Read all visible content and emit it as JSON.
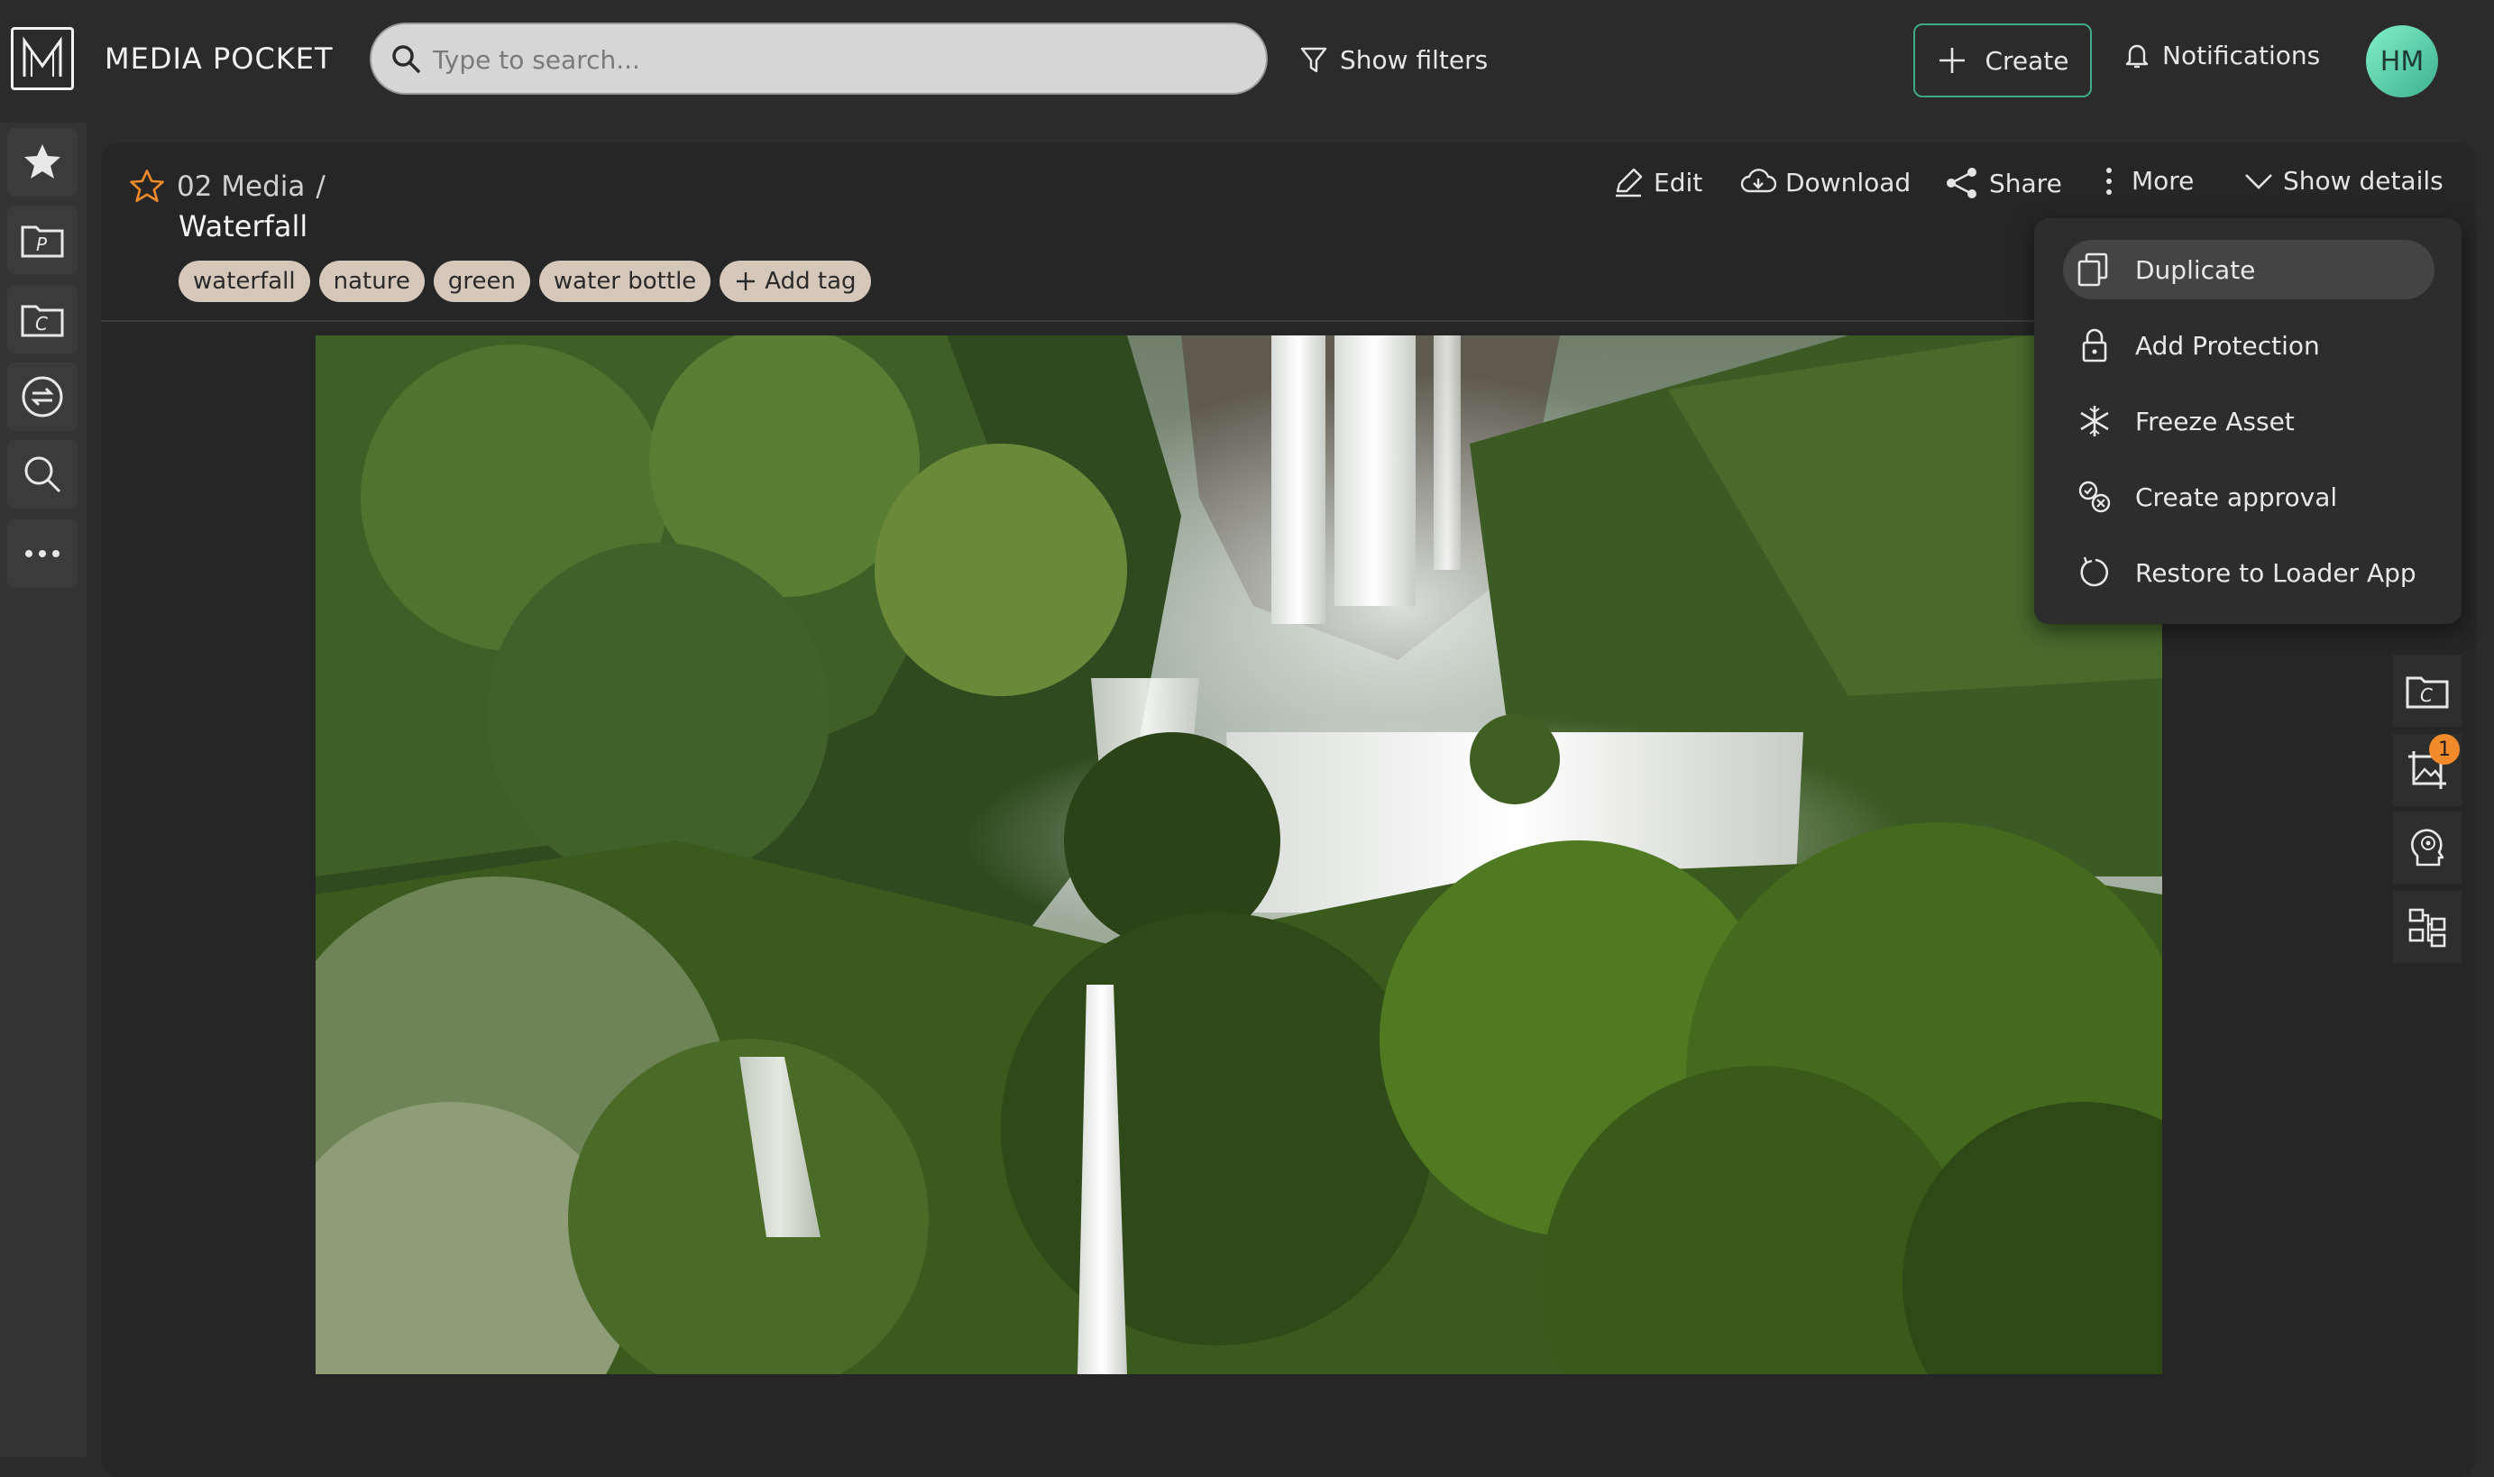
{
  "app": {
    "name": "MEDIA POCKET",
    "logo_letter": "M"
  },
  "search": {
    "placeholder": "Type to search..."
  },
  "header": {
    "show_filters": "Show filters",
    "create": "Create",
    "notifications": "Notifications",
    "avatar_initials": "HM"
  },
  "sidebar": {
    "items": [
      {
        "icon": "star-icon"
      },
      {
        "icon": "folder-p-icon"
      },
      {
        "icon": "folder-c-icon"
      },
      {
        "icon": "transfer-icon"
      },
      {
        "icon": "search-icon"
      },
      {
        "icon": "more-horizontal-icon"
      }
    ]
  },
  "asset": {
    "breadcrumb_parent": "02 Media",
    "breadcrumb_separator": "/",
    "title": "Waterfall",
    "tags": [
      "waterfall",
      "nature",
      "green",
      "water bottle"
    ],
    "add_tag": "Add tag"
  },
  "toolbar": {
    "edit": "Edit",
    "download": "Download",
    "share": "Share",
    "more": "More",
    "show_details": "Show details"
  },
  "more_menu": {
    "items": [
      {
        "label": "Duplicate",
        "icon": "duplicate-icon",
        "active": true
      },
      {
        "label": "Add Protection",
        "icon": "lock-icon"
      },
      {
        "label": "Freeze Asset",
        "icon": "snowflake-icon"
      },
      {
        "label": "Create approval",
        "icon": "approval-icon"
      },
      {
        "label": "Restore to Loader App",
        "icon": "restore-icon"
      }
    ]
  },
  "right_tools": {
    "items": [
      {
        "icon": "folder-c-icon"
      },
      {
        "icon": "image-crop-icon",
        "badge": "1"
      },
      {
        "icon": "ai-head-icon"
      },
      {
        "icon": "hierarchy-icon"
      }
    ]
  },
  "colors": {
    "accent": "#3fa88a",
    "badge": "#f08a2a",
    "tag": "#d6c7bb",
    "star": "#f08a2a"
  }
}
